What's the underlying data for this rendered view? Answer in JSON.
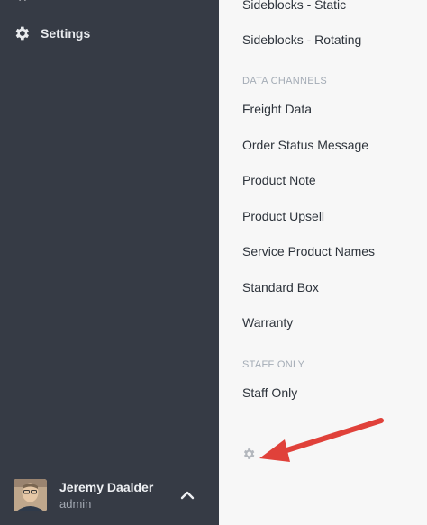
{
  "sidebar": {
    "clipped_icon": "tools-icon",
    "settings": {
      "icon": "gear-icon",
      "label": "Settings"
    },
    "user": {
      "name": "Jeremy Daalder",
      "role": "admin",
      "toggle_icon": "chevron-up-icon"
    }
  },
  "menu": {
    "top_items": [
      "Sideblocks - Static",
      "Sideblocks - Rotating"
    ],
    "data_channels": {
      "heading": "DATA CHANNELS",
      "items": [
        "Freight Data",
        "Order Status Message",
        "Product Note",
        "Product Upsell",
        "Service Product Names",
        "Standard Box",
        "Warranty"
      ]
    },
    "staff_only": {
      "heading": "STAFF ONLY",
      "items": [
        "Staff Only"
      ]
    },
    "settings_icon": "gear-icon"
  },
  "annotation": {
    "icon": "arrow-icon",
    "color": "#e0413a"
  },
  "colors": {
    "sidebar_bg": "#363b45",
    "menu_bg": "#f7f7f7"
  }
}
